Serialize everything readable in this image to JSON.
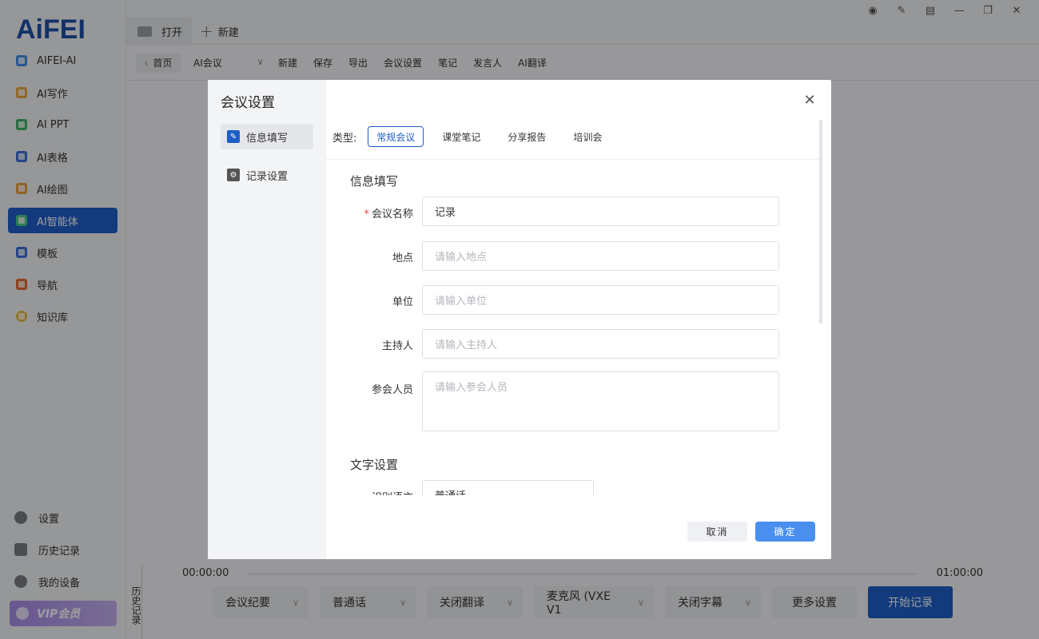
{
  "app": {
    "logo": "AiFEI"
  },
  "sidebar": {
    "items": [
      {
        "label": "AIFEI-AI",
        "color": "#3f8ee8"
      },
      {
        "label": "AI写作",
        "color": "#e8a83f"
      },
      {
        "label": "AI PPT",
        "color": "#3fb36a"
      },
      {
        "label": "AI表格",
        "color": "#3f6fd6"
      },
      {
        "label": "AI绘图",
        "color": "#e8a03f"
      },
      {
        "label": "AI智能体",
        "color": "#4bc88a"
      },
      {
        "label": "模板",
        "color": "#3f6fd6"
      },
      {
        "label": "导航",
        "color": "#e86a2f"
      },
      {
        "label": "知识库",
        "color": "#e8b83f"
      }
    ],
    "active_index": 5,
    "bottom": {
      "settings": "设置",
      "history": "历史记录",
      "devices": "我的设备",
      "vip": "VIP会员"
    }
  },
  "topbar": {
    "open_tab": "打开",
    "new_tab": "新建"
  },
  "toolbar": {
    "home": "首页",
    "mode": "AI会议",
    "items": [
      "新建",
      "保存",
      "导出",
      "会议设置",
      "笔记",
      "发言人",
      "AI翻译"
    ]
  },
  "timeline": {
    "start": "00:00:00",
    "end": "01:00:00",
    "history_tab": "历史记录"
  },
  "bottombar": {
    "summary": "会议纪要",
    "language": "普通话",
    "translate": "关闭翻译",
    "mic": "麦克风 (VXE V1",
    "subtitle": "关闭字幕",
    "more": "更多设置",
    "start": "开始记录"
  },
  "modal": {
    "title": "会议设置",
    "tabs": [
      "信息填写",
      "记录设置"
    ],
    "type_label": "类型:",
    "types": [
      "常规会议",
      "课堂笔记",
      "分享报告",
      "培训会"
    ],
    "active_type": 0,
    "section_info": "信息填写",
    "fields": {
      "name": {
        "label": "会议名称",
        "value": "记录"
      },
      "location": {
        "label": "地点",
        "placeholder": "请输入地点"
      },
      "unit": {
        "label": "单位",
        "placeholder": "请输入单位"
      },
      "host": {
        "label": "主持人",
        "placeholder": "请输入主持人"
      },
      "attendees": {
        "label": "参会人员",
        "placeholder": "请输入参会人员"
      }
    },
    "section_text": "文字设置",
    "recognition": {
      "label": "识别语言",
      "value": "普通话"
    },
    "cancel": "取消",
    "ok": "确定"
  },
  "colors": {
    "primary": "#1d5ec9",
    "confirm": "#4a8ef0",
    "required": "#e0443e"
  }
}
